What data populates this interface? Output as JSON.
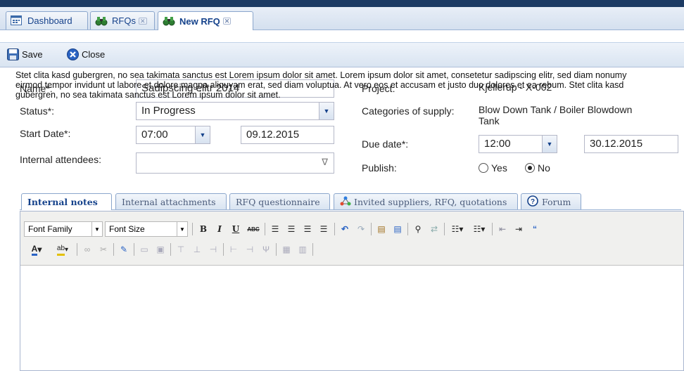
{
  "tabs": [
    {
      "label": "Dashboard",
      "icon": "dashboard-icon",
      "closable": false
    },
    {
      "label": "RFQs",
      "icon": "binoculars-icon",
      "closable": true
    },
    {
      "label": "New RFQ",
      "icon": "binoculars-icon",
      "closable": true,
      "active": true
    }
  ],
  "toolbar": {
    "save_label": "Save",
    "close_label": "Close"
  },
  "form": {
    "name_label": "Name*:",
    "name_value": "Sadipscing elitr 2014",
    "status_label": "Status*:",
    "status_value": "In Progress",
    "start_label": "Start Date*:",
    "start_time": "07:00",
    "start_date": "09.12.2015",
    "attendees_label": "Internal attendees:",
    "project_label": "Project:",
    "project_value": "Kjellerup - X-002",
    "categories_label": "Categories of supply:",
    "categories_value_line1": "Blow Down Tank / Boiler Blowdown",
    "categories_value_line2": "Tank",
    "due_label": "Due date*:",
    "due_time": "12:00",
    "due_date": "30.12.2015",
    "publish_label": "Publish:",
    "publish_yes": "Yes",
    "publish_no": "No",
    "publish_selected": "No"
  },
  "inner_tabs": [
    {
      "label": "Internal notes",
      "active": true
    },
    {
      "label": "Internal attachments"
    },
    {
      "label": "RFQ questionnaire"
    },
    {
      "label": "Invited suppliers, RFQ, quotations",
      "icon": "network-icon"
    },
    {
      "label": "Forum",
      "icon": "help-circle-icon"
    }
  ],
  "editor": {
    "font_family": "Font Family",
    "font_size": "Font Size",
    "content": "Stet clita kasd gubergren, no sea takimata sanctus est Lorem ipsum dolor sit amet. Lorem ipsum dolor sit amet, consetetur sadipscing elitr, sed diam nonumy eirmod tempor invidunt ut labore et dolore magna aliquyam erat, sed diam voluptua. At vero eos et accusam et justo duo dolores et ea rebum. Stet clita kasd gubergren, no sea takimata sanctus est Lorem ipsum dolor sit amet."
  },
  "colors": {
    "accent": "#15428b",
    "topbar": "#1c3a63"
  }
}
